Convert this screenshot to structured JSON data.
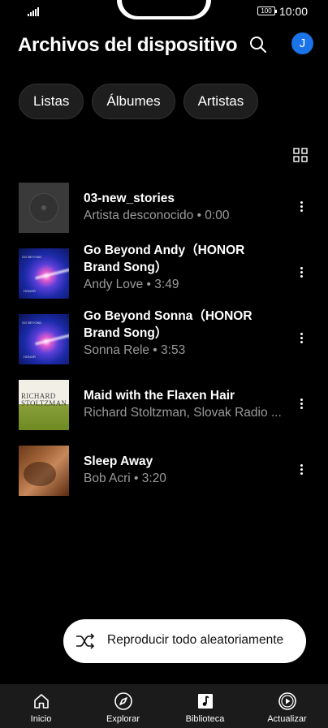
{
  "status_bar": {
    "time": "10:00",
    "battery": "100"
  },
  "header": {
    "title": "Archivos del dispositivo",
    "avatar_letter": "J"
  },
  "chips": [
    "Listas",
    "Álbumes",
    "Artistas"
  ],
  "songs": [
    {
      "title": "03-new_stories",
      "subtitle": "Artista desconocido • 0:00",
      "art": "generic"
    },
    {
      "title": "Go Beyond Andy（HONOR Brand Song）",
      "subtitle": "Andy Love • 3:49",
      "art": "honor"
    },
    {
      "title": "Go Beyond Sonna（HONOR Brand Song）",
      "subtitle": "Sonna Rele • 3:53",
      "art": "honor"
    },
    {
      "title": "Maid with the Flaxen Hair",
      "subtitle": "Richard Stoltzman, Slovak Radio ...",
      "art": "richard"
    },
    {
      "title": "Sleep Away",
      "subtitle": "Bob Acri • 3:20",
      "art": "sleep"
    }
  ],
  "album_art_text": {
    "richard": "RICHARD STOLTZMAN"
  },
  "shuffle_button": {
    "label": "Reproducir todo aleatoriamente",
    "icon": "shuffle-icon"
  },
  "bottom_nav": [
    {
      "label": "Inicio",
      "icon": "home-icon"
    },
    {
      "label": "Explorar",
      "icon": "compass-icon"
    },
    {
      "label": "Biblioteca",
      "icon": "library-icon"
    },
    {
      "label": "Actualizar",
      "icon": "play-circle-icon"
    }
  ],
  "colors": {
    "background": "#000000",
    "accent": "#1a73e8",
    "chip_bg": "#1e1e1e",
    "secondary_text": "#9a9a9a",
    "nav_bg": "#1b1b1b"
  }
}
